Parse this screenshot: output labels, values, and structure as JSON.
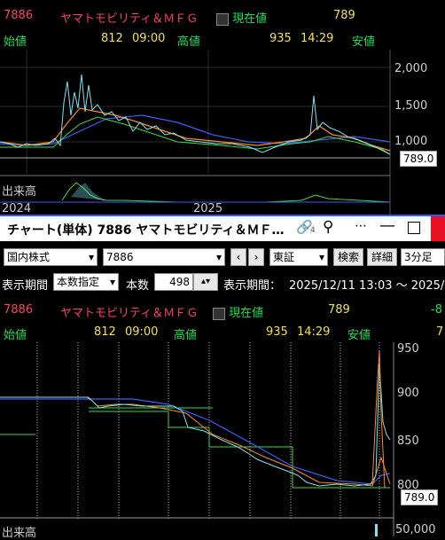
{
  "top_panel": {
    "code": "7886",
    "name": "ヤマトモビリティ＆ＭＦＧ",
    "current_label": "現在値",
    "current_value": "789",
    "open_label": "始値",
    "open_value": "812",
    "open_time": "09:00",
    "high_label": "高値",
    "high_value": "935",
    "high_time": "14:29",
    "low_label": "安値",
    "y_ticks": [
      "2,000",
      "1,500",
      "1,000"
    ],
    "price_tag": "789.0",
    "volume_label": "出来高",
    "x_labels": [
      "2024",
      "2025"
    ]
  },
  "window": {
    "title": "チャート(単体) 7886 ヤマトモビリティ＆ＭＦ…",
    "link_badge": "4",
    "market_select": "国内株式",
    "code_input": "7886",
    "exchange_select": "東証",
    "search_button": "検索",
    "detail_button": "詳細",
    "interval_select": "3分足",
    "period_label": "表示期間",
    "period_mode": "本数指定",
    "bars_label": "本数",
    "bars_value": "498",
    "period_range_label": "表示期間：",
    "period_range": "2025/12/11 13:03 ～ 2025/"
  },
  "bottom_panel": {
    "code": "7886",
    "name": "ヤマトモビリティ＆ＭＦＧ",
    "current_label": "現在値",
    "current_value": "789",
    "change_partial": "-8",
    "open_label": "始値",
    "open_value": "812",
    "open_time": "09:00",
    "high_label": "高値",
    "high_value": "935",
    "high_time": "14:29",
    "low_label": "安値",
    "low_partial": "7",
    "y_ticks": [
      "950",
      "900",
      "850",
      "800"
    ],
    "price_tag": "789.0",
    "volume_label": "出来高",
    "volume_tick": "50,000"
  },
  "colors": {
    "code_name": "#ff3b6b",
    "label_green": "#17e05a",
    "value_yellow": "#f4e24a",
    "candle_cyan": "#7fe3f0",
    "ma_orange": "#ff8c1a",
    "ma_blue": "#3a5cff",
    "line_green": "#3ddc3d"
  }
}
